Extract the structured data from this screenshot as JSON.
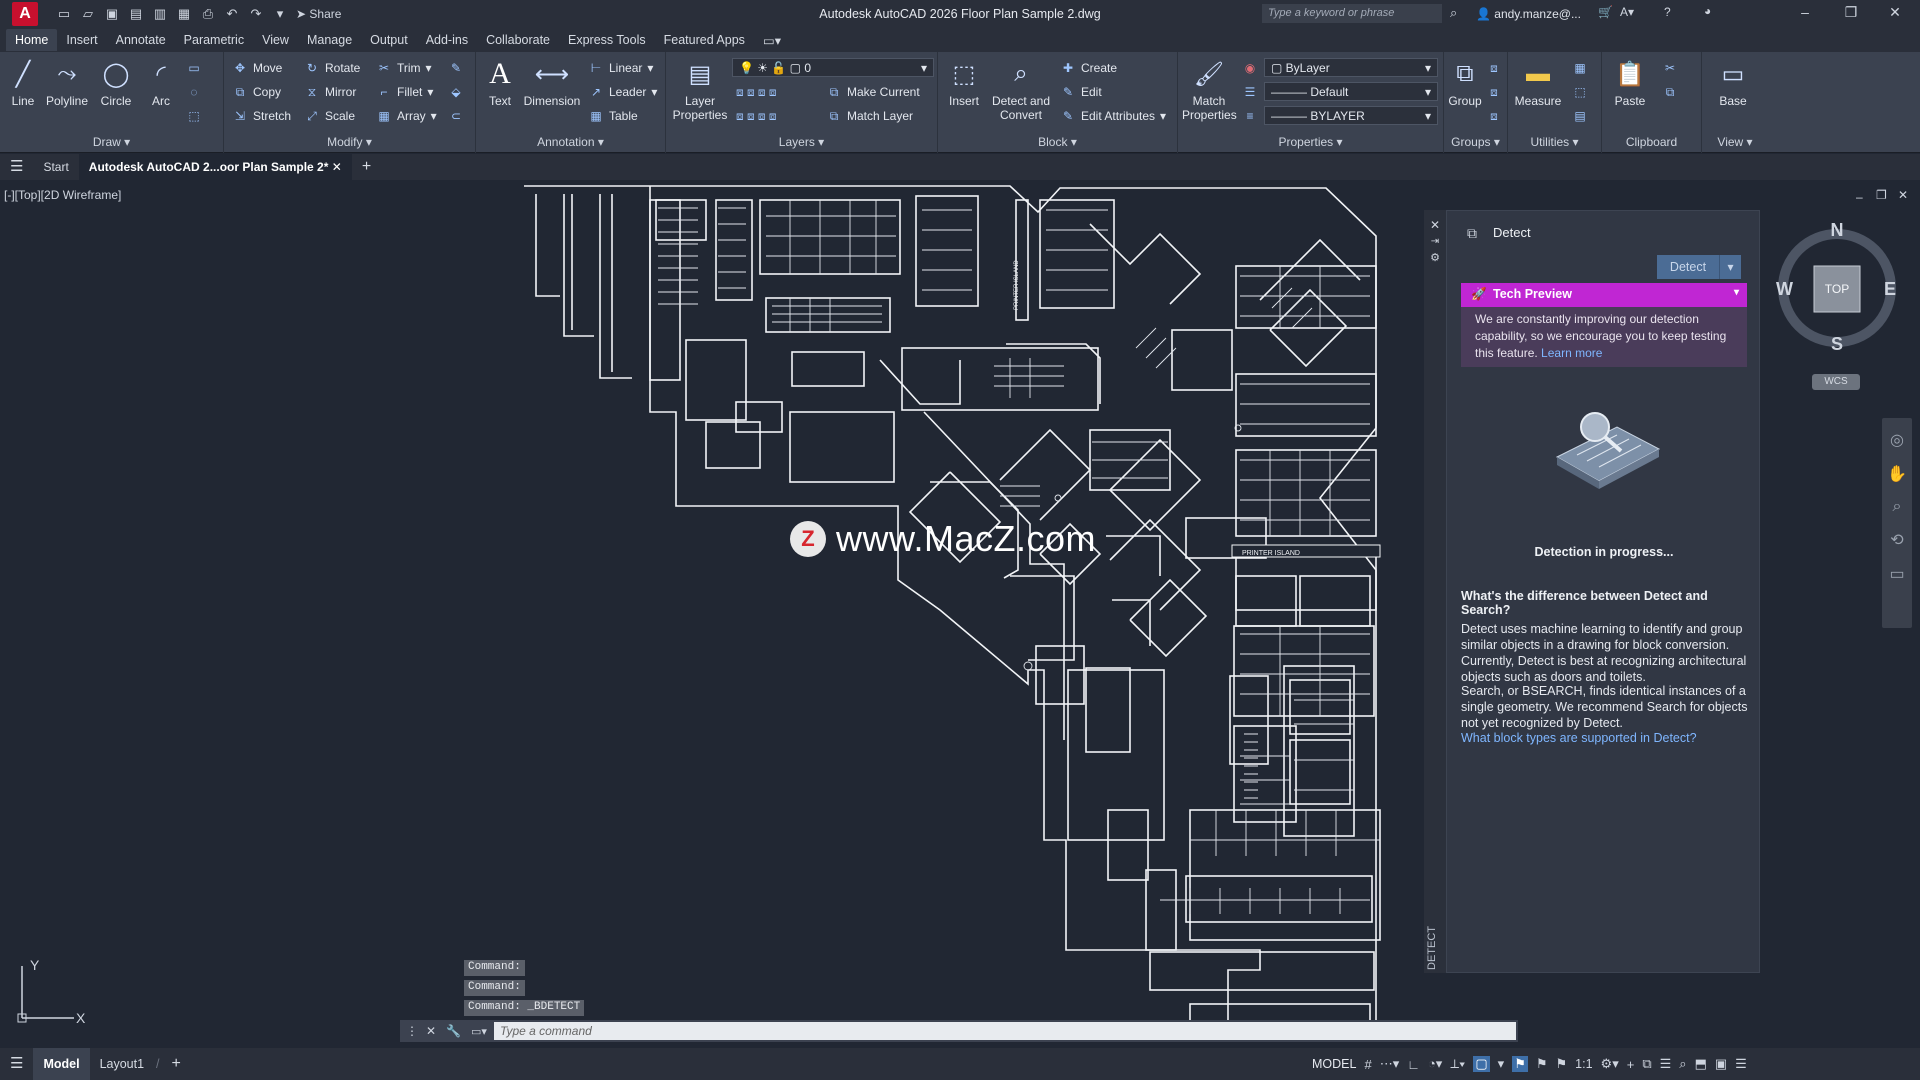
{
  "titlebar": {
    "app_letter": "A",
    "share_label": "Share",
    "window_title": "Autodesk AutoCAD 2026   Floor Plan Sample 2.dwg",
    "search_placeholder": "Type a keyword or phrase",
    "user": "andy.manze@..."
  },
  "ribbon_tabs": [
    "Home",
    "Insert",
    "Annotate",
    "Parametric",
    "View",
    "Manage",
    "Output",
    "Add-ins",
    "Collaborate",
    "Express Tools",
    "Featured Apps"
  ],
  "ribbon": {
    "draw": {
      "title": "Draw",
      "line": "Line",
      "polyline": "Polyline",
      "circle": "Circle",
      "arc": "Arc"
    },
    "modify": {
      "title": "Modify",
      "move": "Move",
      "rotate": "Rotate",
      "trim": "Trim",
      "copy": "Copy",
      "mirror": "Mirror",
      "fillet": "Fillet",
      "stretch": "Stretch",
      "scale": "Scale",
      "array": "Array"
    },
    "annotation": {
      "title": "Annotation",
      "text": "Text",
      "dimension": "Dimension",
      "linear": "Linear",
      "leader": "Leader",
      "table": "Table"
    },
    "layers": {
      "title": "Layers",
      "layer_properties": "Layer Properties",
      "layer_value": "0",
      "make_current": "Make Current",
      "match_layer": "Match Layer"
    },
    "block": {
      "title": "Block",
      "insert": "Insert",
      "detect_convert": "Detect and Convert",
      "create": "Create",
      "edit": "Edit",
      "edit_attributes": "Edit Attributes"
    },
    "properties": {
      "title": "Properties",
      "match_properties": "Match Properties",
      "color": "ByLayer",
      "linetype": "Default",
      "lineweight": "BYLAYER"
    },
    "groups": {
      "title": "Groups",
      "group": "Group"
    },
    "utilities": {
      "title": "Utilities",
      "measure": "Measure"
    },
    "clipboard": {
      "title": "Clipboard",
      "paste": "Paste"
    },
    "view": {
      "title": "View",
      "base": "Base"
    }
  },
  "doc_tabs": {
    "start": "Start",
    "active": "Autodesk AutoCAD 2...oor Plan Sample 2*"
  },
  "viewport_label": "[-][Top][2D Wireframe]",
  "floorplan_labels": [
    "PRINTER ISLAND",
    "PRINTER ISLAND"
  ],
  "watermark": {
    "logo": "Z",
    "text": "www.MacZ.com"
  },
  "detect_palette": {
    "title": "Detect",
    "detect_button": "Detect",
    "tech_preview": "Tech Preview",
    "tech_body": "We are constantly improving our detection capability, so we encourage you to keep testing this feature.",
    "learn_more": "Learn more",
    "progress": "Detection in progress...",
    "question": "What's the difference between Detect and Search?",
    "para1": "Detect uses machine learning to identify and group similar objects in a drawing for block conversion. Currently, Detect is best at recognizing architectural objects such as doors and toilets.",
    "para2": "Search, or BSEARCH, finds identical instances of a single geometry. We recommend Search for objects not yet recognized by Detect.",
    "link": "What block types are supported in Detect?",
    "vertical_label": "DETECT"
  },
  "viewcube": {
    "n": "N",
    "s": "S",
    "e": "E",
    "w": "W",
    "face": "TOP",
    "wcs": "WCS"
  },
  "ucs": {
    "x": "X",
    "y": "Y"
  },
  "command": {
    "history": [
      "Command:",
      "Command:",
      "Command:  _BDETECT"
    ],
    "placeholder": "Type a command"
  },
  "statusbar": {
    "model": "Model",
    "layout1": "Layout1",
    "model_indicator": "MODEL",
    "scale": "1:1"
  },
  "colors": {
    "accent_blue": "#4b6c95",
    "tech_preview": "#c026d3",
    "app_red": "#c8102e",
    "canvas": "#212733"
  }
}
